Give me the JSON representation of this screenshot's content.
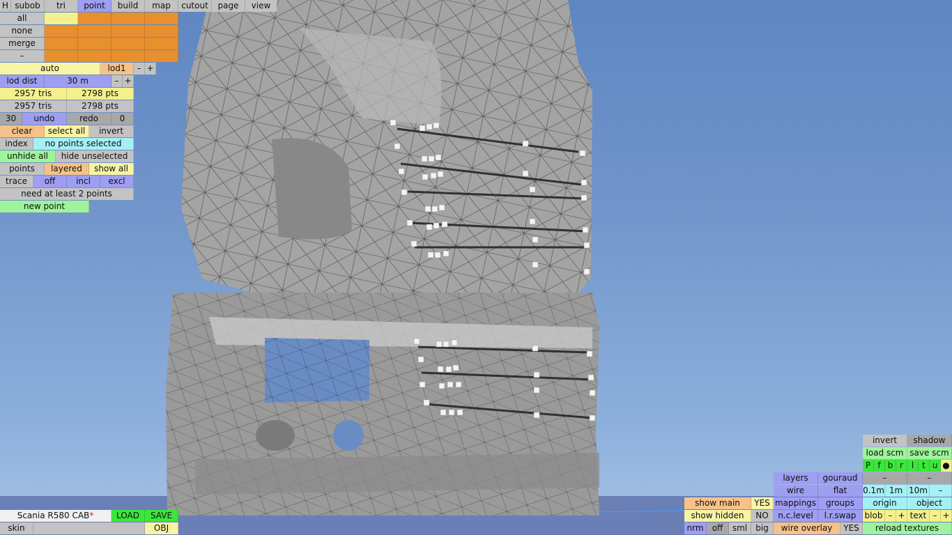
{
  "menu": {
    "h": "H",
    "tabs": [
      "subob",
      "tri",
      "point",
      "build",
      "map",
      "cutout",
      "page",
      "view"
    ],
    "active_tab": "point"
  },
  "select": {
    "all": "all",
    "none": "none",
    "merge": "merge",
    "minus": "–"
  },
  "lod": {
    "auto": "auto",
    "lod1": "lod1",
    "minus": "–",
    "plus": "+",
    "dist_label": "lod dist",
    "dist_value": "30 m",
    "dist_minus": "–",
    "dist_plus": "+",
    "tris1": "2957 tris",
    "pts1": "2798 pts",
    "tris2": "2957 tris",
    "pts2": "2798 pts"
  },
  "history": {
    "count": "30",
    "undo": "undo",
    "redo": "redo",
    "redo_count": "0"
  },
  "selection": {
    "clear": "clear",
    "select_all": "select all",
    "invert": "invert",
    "index": "index",
    "status": "no points selected",
    "unhide_all": "unhide all",
    "hide_unselected": "hide unselected",
    "points": "points",
    "layered": "layered",
    "show_all": "show all",
    "trace": "trace",
    "off": "off",
    "incl": "incl",
    "excl": "excl",
    "need_points": "need at least 2 points",
    "new_point": "new point"
  },
  "file": {
    "name": "Scania R580 CAB",
    "modified_mark": "*",
    "load": "LOAD",
    "save": "SAVE",
    "skin": "skin",
    "obj": "OBJ"
  },
  "view_panel": {
    "invert": "invert",
    "shadow": "shadow",
    "load_scm": "load scm",
    "save_scm": "save scm",
    "channels": [
      "P",
      "f",
      "b",
      "r",
      "l",
      "t",
      "u",
      "●"
    ],
    "layers": "layers",
    "gouraud": "gouraud",
    "dash1": "–",
    "dash2": "–",
    "wire": "wire",
    "flat": "flat",
    "step1": "0.1m",
    "step2": "1m",
    "step3": "10m",
    "step_minus": "–",
    "mappings": "mappings",
    "groups": "groups",
    "origin": "origin",
    "object": "object",
    "ncl": "n.c.level",
    "lrswap": "l.r.swap",
    "blob": "blob",
    "blob_minus": "–",
    "blob_plus": "+",
    "text": "text",
    "text_minus": "–",
    "text_plus": "+",
    "reload": "reload textures",
    "show_main": "show main",
    "show_main_val": "YES",
    "show_hidden": "show hidden",
    "show_hidden_val": "NO",
    "nrm": "nrm",
    "nrm_off": "off",
    "sml": "sml",
    "big": "big",
    "wire_overlay": "wire overlay",
    "wire_overlay_val": "YES"
  }
}
